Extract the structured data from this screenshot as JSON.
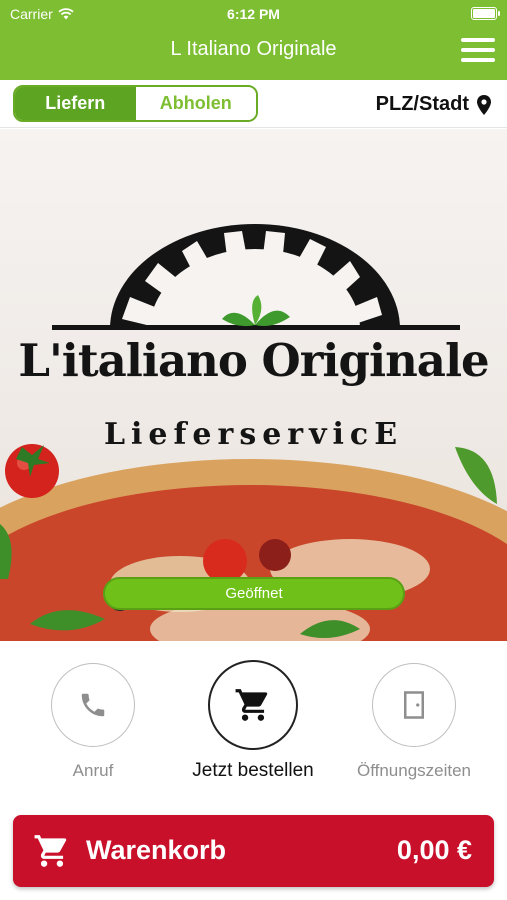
{
  "status_bar": {
    "carrier": "Carrier",
    "time": "6:12 PM"
  },
  "navbar": {
    "title": "L Italiano Originale",
    "menu_icon": "hamburger-menu-icon"
  },
  "mode_toggle": {
    "options": [
      "Liefern",
      "Abholen"
    ],
    "selected": "Liefern"
  },
  "location": {
    "label": "PLZ/Stadt",
    "icon": "map-pin-icon"
  },
  "hero": {
    "logo_title": "L'italiano Originale",
    "logo_subtitle": "LieferservicE",
    "status_label": "Geöffnet"
  },
  "actions": [
    {
      "label": "Anruf",
      "icon": "phone-icon"
    },
    {
      "label": "Jetzt bestellen",
      "icon": "cart-icon"
    },
    {
      "label": "Öffnungszeiten",
      "icon": "door-icon"
    }
  ],
  "cart": {
    "label": "Warenkorb",
    "total": "0,00 €",
    "icon": "cart-icon"
  },
  "colors": {
    "primary_green": "#7dbe32",
    "dark_green": "#5da423",
    "open_green": "#6fc119",
    "cart_red": "#c9102b"
  }
}
